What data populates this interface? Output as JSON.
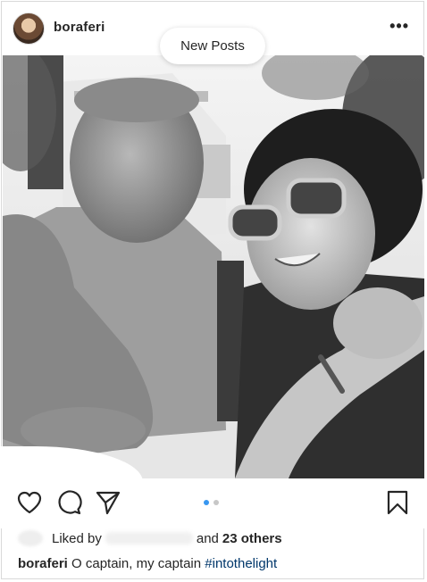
{
  "post": {
    "username": "boraferi",
    "more_label": "•••",
    "new_posts_label": "New Posts",
    "photo_alt": "Black and white selfie photo",
    "carousel": {
      "count": 2,
      "active": 1
    },
    "likes": {
      "prefix": "Liked by",
      "middle": "and",
      "others": "23 others"
    },
    "caption": {
      "username": "boraferi",
      "text": "O captain, my captain",
      "hashtag": "#intothelight"
    }
  },
  "colors": {
    "text": "#262626",
    "dot_active": "#3897f0",
    "dot_inactive": "#c7c7c7",
    "hashtag": "#00376b"
  },
  "icons": [
    "heart-icon",
    "comment-icon",
    "share-icon",
    "bookmark-icon",
    "more-icon"
  ]
}
